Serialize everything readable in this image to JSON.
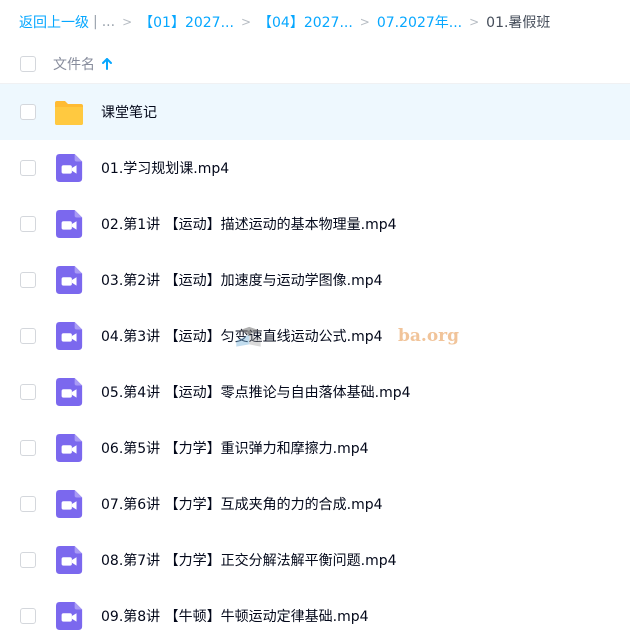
{
  "breadcrumb": {
    "back": "返回上一级",
    "divider": "|",
    "ellipsis": "...",
    "crumbs": [
      "【01】2027...",
      "【04】2027...",
      "07.2027年..."
    ],
    "current": "01.暑假班"
  },
  "header": {
    "name_label": "文件名"
  },
  "watermark": {
    "text": "ba.org"
  },
  "files": [
    {
      "name": "课堂笔记",
      "type": "folder",
      "icon": "folder-icon"
    },
    {
      "name": "01.学习规划课.mp4",
      "type": "video",
      "icon": "video-file-icon"
    },
    {
      "name": "02.第1讲 【运动】描述运动的基本物理量.mp4",
      "type": "video",
      "icon": "video-file-icon"
    },
    {
      "name": "03.第2讲 【运动】加速度与运动学图像.mp4",
      "type": "video",
      "icon": "video-file-icon"
    },
    {
      "name": "04.第3讲 【运动】匀变速直线运动公式.mp4",
      "type": "video",
      "icon": "video-file-icon"
    },
    {
      "name": "05.第4讲 【运动】零点推论与自由落体基础.mp4",
      "type": "video",
      "icon": "video-file-icon"
    },
    {
      "name": "06.第5讲 【力学】重识弹力和摩擦力.mp4",
      "type": "video",
      "icon": "video-file-icon"
    },
    {
      "name": "07.第6讲 【力学】互成夹角的力的合成.mp4",
      "type": "video",
      "icon": "video-file-icon"
    },
    {
      "name": "08.第7讲 【力学】正交分解法解平衡问题.mp4",
      "type": "video",
      "icon": "video-file-icon"
    },
    {
      "name": "09.第8讲 【牛顿】牛顿运动定律基础.mp4",
      "type": "video",
      "icon": "video-file-icon"
    }
  ],
  "colors": {
    "link": "#06a7ff",
    "folder": "#ffc440",
    "video": "#7b61ff",
    "selected_row": "#eef8fe"
  }
}
